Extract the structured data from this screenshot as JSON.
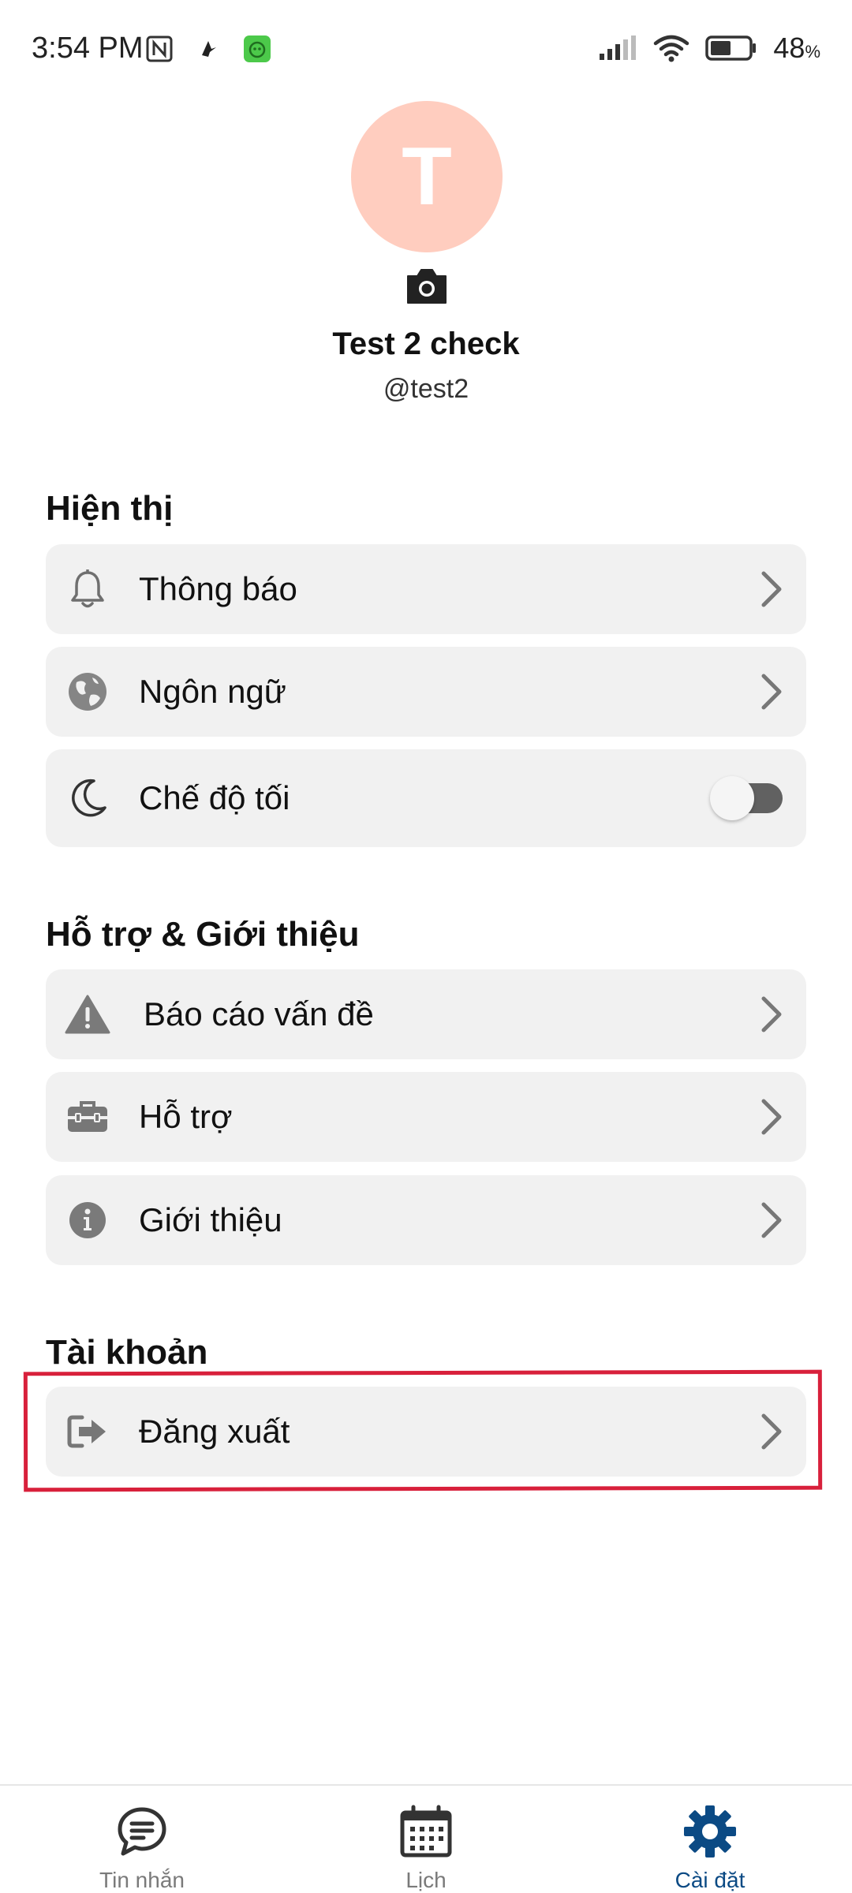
{
  "status_bar": {
    "time": "3:54 PM",
    "battery_percent": "48",
    "battery_unit": "%"
  },
  "profile": {
    "avatar_initial": "T",
    "avatar_color": "#ffcdbf",
    "name": "Test 2 check",
    "handle": "@test2"
  },
  "sections": {
    "display": {
      "title": "Hiện thị",
      "items": [
        {
          "label": "Thông báo",
          "icon": "bell-icon"
        },
        {
          "label": "Ngôn ngữ",
          "icon": "globe-icon"
        },
        {
          "label": "Chế độ tối",
          "icon": "moon-icon",
          "toggle_on": false
        }
      ]
    },
    "support": {
      "title": "Hỗ trợ & Giới thiệu",
      "items": [
        {
          "label": "Báo cáo vấn đề",
          "icon": "warning-icon"
        },
        {
          "label": "Hỗ trợ",
          "icon": "toolbox-icon"
        },
        {
          "label": "Giới thiệu",
          "icon": "info-icon"
        }
      ]
    },
    "account": {
      "title": "Tài khoản",
      "items": [
        {
          "label": "Đăng xuất",
          "icon": "logout-icon"
        }
      ]
    }
  },
  "bottom_nav": {
    "items": [
      {
        "label": "Tin nhắn",
        "icon": "chat-icon",
        "active": false
      },
      {
        "label": "Lịch",
        "icon": "calendar-icon",
        "active": false
      },
      {
        "label": "Cài đặt",
        "icon": "gear-icon",
        "active": true
      }
    ]
  },
  "colors": {
    "accent": "#0b4a84",
    "highlight_border": "#d8203b",
    "row_background": "#f1f1f1"
  }
}
